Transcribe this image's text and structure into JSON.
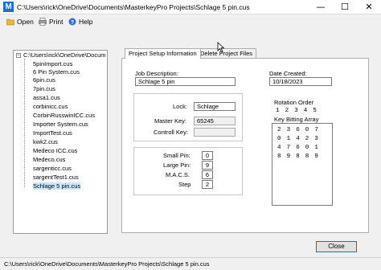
{
  "window": {
    "title": "C:\\Users\\rick\\OneDrive\\Documents\\MasterkeyPro Projects\\Schlage 5 pin.cus",
    "app_icon_letter": "M",
    "minimize": "—",
    "maximize": "☐",
    "close": "✕"
  },
  "menu": {
    "open": "Open",
    "print": "Print",
    "help": "Help"
  },
  "tree": {
    "root": "C:\\Users\\rick\\OneDrive\\Docum",
    "expander": "−",
    "items": [
      "5pinImport.cus",
      "6 Pin System.cus",
      "6pin.cus",
      "7pin.cus",
      "assa1.cus",
      "corbinicc.cus",
      "CorbinRusswinICC.cus",
      "Importer System.cus",
      "ImportTest.cus",
      "kwk2.cus",
      "Medeco ICC.cus",
      "Medeco.cus",
      "sargenticc.cus",
      "sargentTest1.cus",
      "Schlage 5 pin.cus"
    ]
  },
  "tabs": [
    "Project Setup Information",
    "Delete Project Files"
  ],
  "form": {
    "job_description_label": "Job Description:",
    "job_description": "Schlage 5 pin",
    "date_created_label": "Date Created:",
    "date_created": "10/18/2023",
    "lock_label": "Lock:",
    "lock": "Schlage",
    "master_key_label": "Master Key:",
    "master_key": "65245",
    "control_key_label": "Controll Key:",
    "control_key": "",
    "small_pin_label": "Small Pin:",
    "small_pin": "0",
    "large_pin_label": "Large Pin:",
    "large_pin": "9",
    "macs_label": "M.A.C.S.",
    "macs": "6",
    "step_label": "Step",
    "step": "2",
    "rotation_order_label": "Rotation Order",
    "rotation_order": "1 2 3 4 5",
    "key_bitting_label": "Key Bitting Array",
    "key_bitting_rows": [
      "2 3 6 0 7",
      "0 1 4 2 3",
      "4 7 6 0 1",
      "8 9 8 8 9"
    ]
  },
  "buttons": {
    "close": "Close"
  },
  "status": {
    "path": "C:\\Users\\rick\\OneDrive\\Documents\\MasterkeyPro Projects\\Schlage 5 pin.cus"
  }
}
